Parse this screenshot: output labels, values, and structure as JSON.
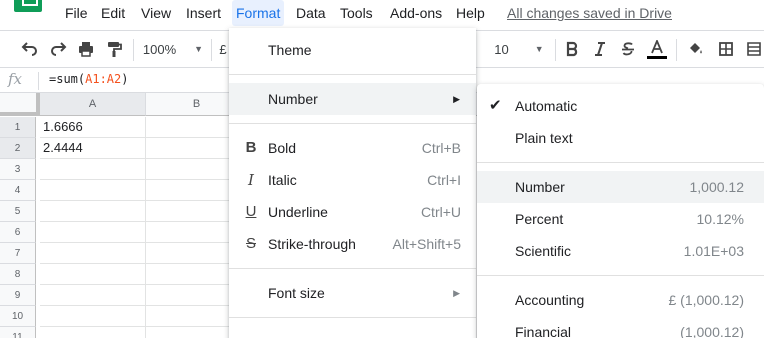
{
  "menubar": {
    "items": [
      "File",
      "Edit",
      "View",
      "Insert",
      "Format",
      "Data",
      "Tools",
      "Add-ons",
      "Help"
    ],
    "save_status": "All changes saved in Drive"
  },
  "toolbar": {
    "zoom": "100%",
    "currency_symbol": "£",
    "font_size": "10"
  },
  "formula_bar": {
    "fx_label": "fx",
    "formula_prefix": "=sum(",
    "formula_ref": "A1:A2",
    "formula_suffix": ")"
  },
  "grid": {
    "columns": [
      "A",
      "B"
    ],
    "rows": [
      "1",
      "2",
      "3",
      "4",
      "5",
      "6",
      "7",
      "8",
      "9",
      "10",
      "11"
    ],
    "cells": [
      {
        "row": "1",
        "col": "A",
        "value": "1.6666"
      },
      {
        "row": "2",
        "col": "A",
        "value": "2.4444"
      }
    ]
  },
  "format_menu": {
    "items": [
      {
        "label": "Theme",
        "icon": "",
        "shortcut": "",
        "submenu": false
      },
      {
        "label": "Number",
        "icon": "",
        "shortcut": "",
        "submenu": true
      },
      {
        "label": "Bold",
        "icon": "bold-icon",
        "shortcut": "Ctrl+B",
        "submenu": false
      },
      {
        "label": "Italic",
        "icon": "italic-icon",
        "shortcut": "Ctrl+I",
        "submenu": false
      },
      {
        "label": "Underline",
        "icon": "underline-icon",
        "shortcut": "Ctrl+U",
        "submenu": false
      },
      {
        "label": "Strike-through",
        "icon": "strikethrough-icon",
        "shortcut": "Alt+Shift+5",
        "submenu": false
      },
      {
        "label": "Font size",
        "icon": "",
        "shortcut": "",
        "submenu": true
      }
    ]
  },
  "number_menu": {
    "items": [
      {
        "label": "Automatic",
        "example": "",
        "checked": true
      },
      {
        "label": "Plain text",
        "example": "",
        "checked": false
      },
      {
        "label": "Number",
        "example": "1,000.12",
        "checked": false
      },
      {
        "label": "Percent",
        "example": "10.12%",
        "checked": false
      },
      {
        "label": "Scientific",
        "example": "1.01E+03",
        "checked": false
      },
      {
        "label": "Accounting",
        "example": "£ (1,000.12)",
        "checked": false
      },
      {
        "label": "Financial",
        "example": "(1,000.12)",
        "checked": false
      }
    ]
  },
  "colors": {
    "accent_blue": "#1a73e8",
    "menu_active_bg": "#e8f0fe",
    "sheets_green": "#0f9d58",
    "formula_ref": "#f4511e"
  }
}
